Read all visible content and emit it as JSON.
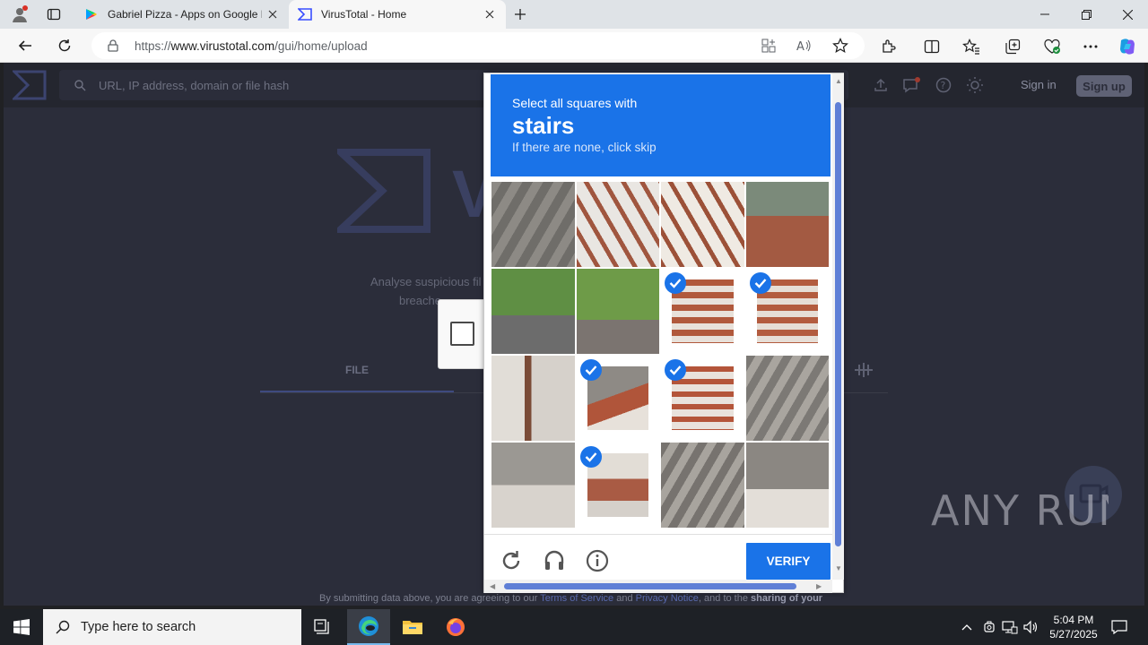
{
  "browser": {
    "tabs": [
      {
        "title": "Gabriel Pizza - Apps on Google P",
        "active": false
      },
      {
        "title": "VirusTotal - Home",
        "active": true
      }
    ],
    "url_prefix": "https://",
    "url_host": "www.virustotal.com",
    "url_path": "/gui/home/upload"
  },
  "vt": {
    "search_placeholder": "URL, IP address, domain or file hash",
    "sign_in": "Sign in",
    "sign_up": "Sign up",
    "big_text": "V",
    "analyse_text": "Analyse suspicious fil",
    "breach_text": "breache",
    "file_tab": "FILE",
    "footer_start": "By submitting data above, you are agreeing to our ",
    "footer_terms": "Terms of Service",
    "footer_and": " and ",
    "footer_privacy": "Privacy Notice",
    "footer_mid": ", and to the ",
    "footer_bold": "sharing of your"
  },
  "captcha": {
    "select_text": "Select all squares with",
    "target_word": "stairs",
    "skip_text": "If there are none, click skip",
    "verify_label": "VERIFY",
    "selected_tiles": [
      6,
      7,
      9,
      10,
      13
    ]
  },
  "watermark": {
    "text": "ANY RUN"
  },
  "taskbar": {
    "search_placeholder": "Type here to search",
    "time": "5:04 PM",
    "date": "5/27/2025"
  },
  "colors": {
    "captcha_blue": "#1a73e8",
    "vt_dark": "#2b2d3a"
  }
}
